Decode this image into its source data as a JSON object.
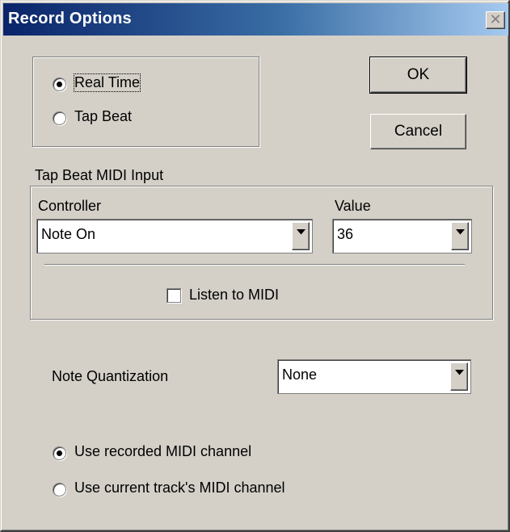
{
  "window": {
    "title": "Record Options",
    "close_glyph": "✕"
  },
  "record_mode": {
    "options": [
      "Real Time",
      "Tap Beat"
    ],
    "selected": "Real Time"
  },
  "buttons": {
    "ok": "OK",
    "cancel": "Cancel"
  },
  "tap_beat": {
    "group_label": "Tap Beat MIDI Input",
    "controller_label": "Controller",
    "controller_value": "Note On",
    "value_label": "Value",
    "value_value": "36",
    "listen_label": "Listen to MIDI",
    "listen_checked": false
  },
  "quantization": {
    "label": "Note Quantization",
    "value": "None"
  },
  "channel": {
    "options": [
      "Use recorded MIDI channel",
      "Use current track's MIDI channel"
    ],
    "selected": "Use recorded MIDI channel"
  }
}
